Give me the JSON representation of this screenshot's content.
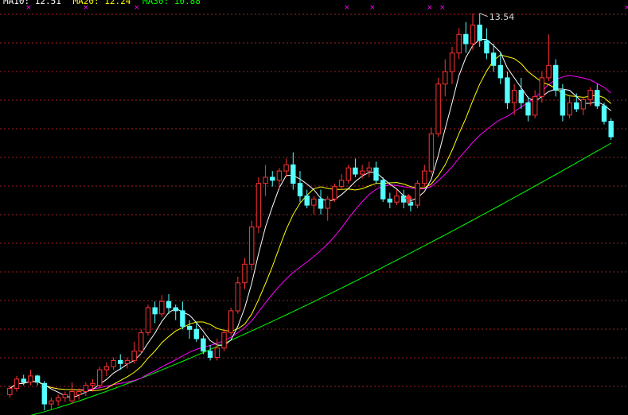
{
  "chart_data": {
    "type": "candlestick",
    "y_range": [
      7.2,
      13.6
    ],
    "high_marker": {
      "value": 13.54,
      "label": "13.54",
      "bar_index": 68
    },
    "legend": [
      {
        "name": "MA10",
        "text": "MA10: 12.51",
        "color": "#ffffff"
      },
      {
        "name": "MA20",
        "text": "MA20: 12.24",
        "color": "#ffff00"
      },
      {
        "name": "MA30",
        "text": "MA30: 10.88",
        "color": "#00ff00"
      }
    ],
    "colors": {
      "background": "#000000",
      "up": "#ff3232",
      "down": "#54ffff",
      "ma_short": "#ffffff",
      "ma_mid": "#ffff00",
      "ma_long": "#ff00ff",
      "ma_very_long": "#00ff00",
      "grid": "#a02020",
      "marker": "#ff00ff",
      "arrow": "#ff2020"
    },
    "candles": [
      [
        7.4,
        7.55,
        7.35,
        7.5
      ],
      [
        7.5,
        7.7,
        7.45,
        7.65
      ],
      [
        7.65,
        7.72,
        7.55,
        7.6
      ],
      [
        7.6,
        7.8,
        7.55,
        7.7
      ],
      [
        7.7,
        7.72,
        7.55,
        7.6
      ],
      [
        7.58,
        7.62,
        7.15,
        7.25
      ],
      [
        7.25,
        7.35,
        7.15,
        7.3
      ],
      [
        7.3,
        7.4,
        7.22,
        7.35
      ],
      [
        7.35,
        7.45,
        7.28,
        7.4
      ],
      [
        7.3,
        7.6,
        7.25,
        7.45
      ],
      [
        7.4,
        7.5,
        7.32,
        7.45
      ],
      [
        7.45,
        7.6,
        7.38,
        7.55
      ],
      [
        7.55,
        7.65,
        7.45,
        7.58
      ],
      [
        7.55,
        7.85,
        7.5,
        7.8
      ],
      [
        7.8,
        7.92,
        7.7,
        7.85
      ],
      [
        7.85,
        8.0,
        7.8,
        7.95
      ],
      [
        7.95,
        8.05,
        7.8,
        7.9
      ],
      [
        7.9,
        8.0,
        7.82,
        7.95
      ],
      [
        7.95,
        8.25,
        7.9,
        8.1
      ],
      [
        8.1,
        8.45,
        8.05,
        8.4
      ],
      [
        8.4,
        8.85,
        8.35,
        8.8
      ],
      [
        8.8,
        8.9,
        8.55,
        8.7
      ],
      [
        8.7,
        9.0,
        8.65,
        8.9
      ],
      [
        8.9,
        9.02,
        8.7,
        8.8
      ],
      [
        8.8,
        8.85,
        8.6,
        8.75
      ],
      [
        8.75,
        8.9,
        8.45,
        8.5
      ],
      [
        8.5,
        8.6,
        8.3,
        8.45
      ],
      [
        8.45,
        8.55,
        8.25,
        8.3
      ],
      [
        8.3,
        8.35,
        8.05,
        8.1
      ],
      [
        8.1,
        8.2,
        7.95,
        8.0
      ],
      [
        8.0,
        8.3,
        7.95,
        8.15
      ],
      [
        8.15,
        8.45,
        8.1,
        8.4
      ],
      [
        8.4,
        8.8,
        8.35,
        8.75
      ],
      [
        8.75,
        9.3,
        8.7,
        9.2
      ],
      [
        9.2,
        9.6,
        9.1,
        9.5
      ],
      [
        9.5,
        10.2,
        9.4,
        10.1
      ],
      [
        10.1,
        10.9,
        10.0,
        10.8
      ],
      [
        10.8,
        11.1,
        10.6,
        10.9
      ],
      [
        10.9,
        11.0,
        10.75,
        10.85
      ],
      [
        10.85,
        11.05,
        10.7,
        11.0
      ],
      [
        11.0,
        11.2,
        10.9,
        11.1
      ],
      [
        11.1,
        11.3,
        10.7,
        10.8
      ],
      [
        10.8,
        11.0,
        10.5,
        10.6
      ],
      [
        10.6,
        10.7,
        10.4,
        10.45
      ],
      [
        10.45,
        10.6,
        10.3,
        10.55
      ],
      [
        10.55,
        10.7,
        10.3,
        10.4
      ],
      [
        10.4,
        10.6,
        10.2,
        10.55
      ],
      [
        10.55,
        10.8,
        10.5,
        10.75
      ],
      [
        10.75,
        10.95,
        10.7,
        10.85
      ],
      [
        10.85,
        11.1,
        10.8,
        11.05
      ],
      [
        11.05,
        11.2,
        10.9,
        10.95
      ],
      [
        10.95,
        11.1,
        10.88,
        11.0
      ],
      [
        11.0,
        11.15,
        10.9,
        11.05
      ],
      [
        11.05,
        11.15,
        10.8,
        10.85
      ],
      [
        10.85,
        10.9,
        10.5,
        10.55
      ],
      [
        10.55,
        10.65,
        10.4,
        10.5
      ],
      [
        10.5,
        10.7,
        10.45,
        10.6
      ],
      [
        10.6,
        10.7,
        10.4,
        10.5
      ],
      [
        10.5,
        10.6,
        10.35,
        10.45
      ],
      [
        10.45,
        10.85,
        10.4,
        10.8
      ],
      [
        10.8,
        11.1,
        10.75,
        11.0
      ],
      [
        11.0,
        11.7,
        10.95,
        11.6
      ],
      [
        11.6,
        12.5,
        11.55,
        12.4
      ],
      [
        12.4,
        12.8,
        12.2,
        12.6
      ],
      [
        12.6,
        13.0,
        12.4,
        12.9
      ],
      [
        12.9,
        13.3,
        12.8,
        13.2
      ],
      [
        13.2,
        13.4,
        12.9,
        13.05
      ],
      [
        13.05,
        13.54,
        12.95,
        13.35
      ],
      [
        13.35,
        13.54,
        13.0,
        13.1
      ],
      [
        13.1,
        13.3,
        12.8,
        12.9
      ],
      [
        12.9,
        13.05,
        12.6,
        12.7
      ],
      [
        12.7,
        12.9,
        12.4,
        12.5
      ],
      [
        12.5,
        12.6,
        12.0,
        12.1
      ],
      [
        12.1,
        12.4,
        11.9,
        12.3
      ],
      [
        12.3,
        12.5,
        12.0,
        12.1
      ],
      [
        12.1,
        12.2,
        11.8,
        11.9
      ],
      [
        11.9,
        12.3,
        11.85,
        12.2
      ],
      [
        12.2,
        12.6,
        12.1,
        12.5
      ],
      [
        12.5,
        13.2,
        12.45,
        12.7
      ],
      [
        12.7,
        12.8,
        12.2,
        12.3
      ],
      [
        12.3,
        12.4,
        11.8,
        11.9
      ],
      [
        11.9,
        12.2,
        11.85,
        12.1
      ],
      [
        12.1,
        12.25,
        11.95,
        12.0
      ],
      [
        12.0,
        12.2,
        11.9,
        12.15
      ],
      [
        12.15,
        12.35,
        12.05,
        12.3
      ],
      [
        12.3,
        12.4,
        12.0,
        12.05
      ],
      [
        12.05,
        12.1,
        11.75,
        11.8
      ],
      [
        11.8,
        11.85,
        11.5,
        11.55
      ]
    ]
  }
}
